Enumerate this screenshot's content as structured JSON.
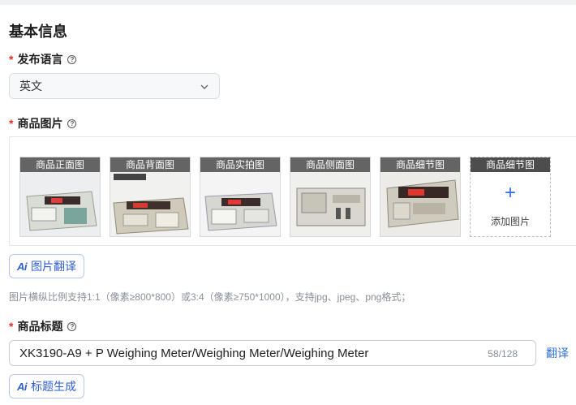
{
  "section": {
    "title": "基本信息"
  },
  "language": {
    "required_mark": "*",
    "label": "发布语言",
    "help_glyph": "?",
    "selected": "英文"
  },
  "images": {
    "required_mark": "*",
    "label": "商品图片",
    "help_glyph": "?",
    "cards": [
      {
        "caption": "商品正面图"
      },
      {
        "caption": "商品背面图"
      },
      {
        "caption": "商品实拍图"
      },
      {
        "caption": "商品侧面图"
      },
      {
        "caption": "商品细节图"
      }
    ],
    "add_card": {
      "caption": "商品细节图",
      "plus": "+",
      "label": "添加图片"
    },
    "ai_button": {
      "icon_text": "Ai",
      "label": "图片翻译"
    },
    "hint": "图片横纵比例支持1:1（像素≥800*800）或3:4（像素≥750*1000），支持jpg、jpeg、png格式；"
  },
  "title_field": {
    "required_mark": "*",
    "label": "商品标题",
    "help_glyph": "?",
    "value": "XK3190-A9 + P Weighing Meter/Weighing Meter/Weighing Meter",
    "counter": "58/128",
    "translate_label": "翻译",
    "ai_button": {
      "icon_text": "Ai",
      "label": "标题生成"
    }
  }
}
